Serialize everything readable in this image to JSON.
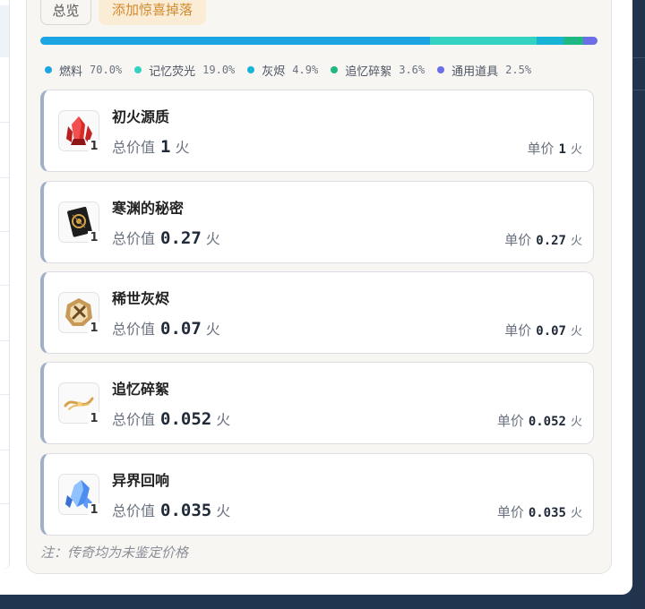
{
  "tabs": [
    {
      "label": "总览"
    },
    {
      "label": "添加惊喜掉落"
    }
  ],
  "progress": [
    {
      "name": "燃料",
      "pct": 70.0,
      "color": "#1ba6e3"
    },
    {
      "name": "记忆荧光",
      "pct": 19.0,
      "color": "#34d3c1"
    },
    {
      "name": "灰烬",
      "pct": 4.9,
      "color": "#18b4d6"
    },
    {
      "name": "追忆碎絮",
      "pct": 3.6,
      "color": "#1fb782"
    },
    {
      "name": "通用道具",
      "pct": 2.5,
      "color": "#6b6ee6"
    }
  ],
  "legend": [
    {
      "name": "燃料",
      "pct": "70.0%",
      "color": "#1ba6e3"
    },
    {
      "name": "记忆荧光",
      "pct": "19.0%",
      "color": "#34d3c1"
    },
    {
      "name": "灰烬",
      "pct": "4.9%",
      "color": "#18b4d6"
    },
    {
      "name": "追忆碎絮",
      "pct": "3.6%",
      "color": "#1fb782"
    },
    {
      "name": "通用道具",
      "pct": "2.5%",
      "color": "#6b6ee6"
    }
  ],
  "labels": {
    "total": "总价值",
    "unit": "单价",
    "currency": "火"
  },
  "items": [
    {
      "name": "初火源质",
      "count": "1",
      "total": "1",
      "unit": "1",
      "icon": "red-crystal-icon"
    },
    {
      "name": "寒渊的秘密",
      "count": "1",
      "total": "0.27",
      "unit": "0.27",
      "icon": "dark-card-icon"
    },
    {
      "name": "稀世灰烬",
      "count": "1",
      "total": "0.07",
      "unit": "0.07",
      "icon": "gold-medallion-icon"
    },
    {
      "name": "追忆碎絮",
      "count": "1",
      "total": "0.052",
      "unit": "0.052",
      "icon": "golden-swirl-icon"
    },
    {
      "name": "异界回响",
      "count": "1",
      "total": "0.035",
      "unit": "0.035",
      "icon": "blue-crystal-icon"
    }
  ],
  "note": "注：传奇均为未鉴定价格"
}
